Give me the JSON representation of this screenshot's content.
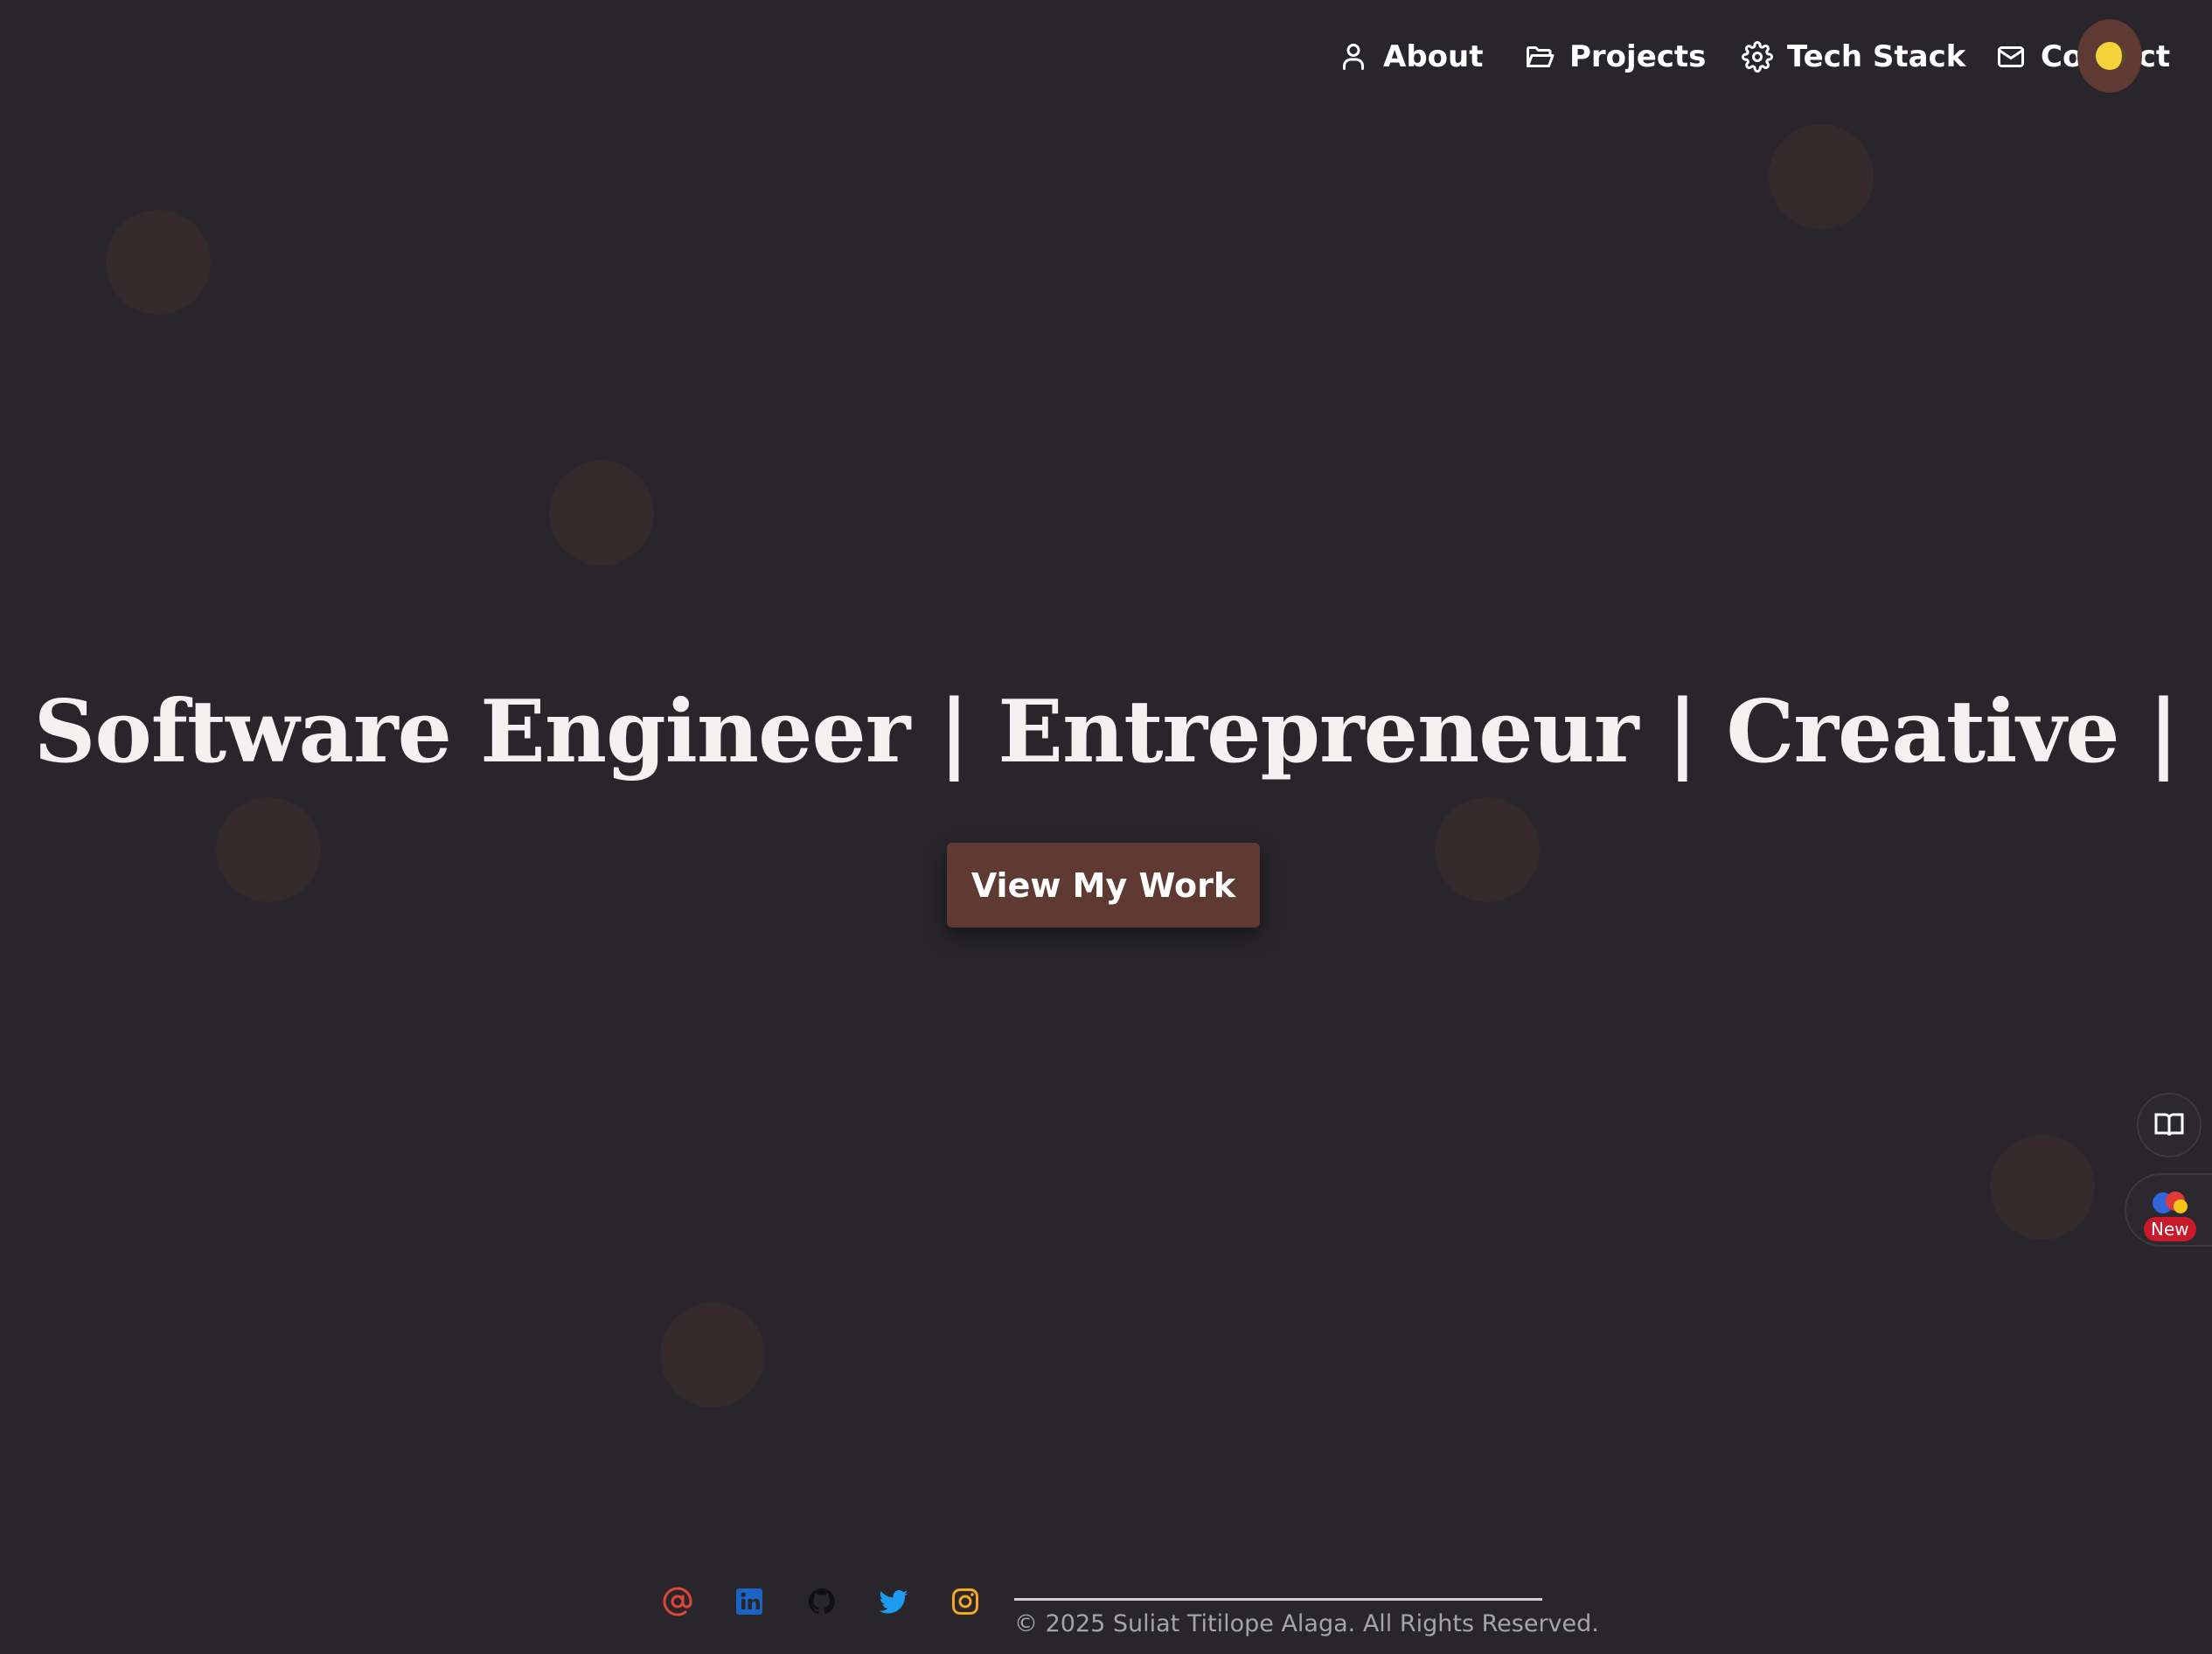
{
  "nav": {
    "items": [
      {
        "label": "About",
        "icon": "user-icon"
      },
      {
        "label": "Projects",
        "icon": "folder-icon"
      },
      {
        "label": "Tech Stack",
        "icon": "gear-icon"
      },
      {
        "label": "Contact",
        "icon": "mail-icon"
      }
    ],
    "theme_toggle_icon": "moon-icon"
  },
  "hero": {
    "headline": "Software Engineer | Entrepreneur | Creative |",
    "cta_label": "View My Work"
  },
  "side_widgets": {
    "book_icon": "book-icon",
    "new_badge": "New"
  },
  "footer": {
    "social": [
      "email-icon",
      "linkedin-icon",
      "github-icon",
      "twitter-icon",
      "instagram-icon"
    ],
    "copyright": "© 2025 Suliat Titilope Alaga. All Rights Reserved."
  },
  "colors": {
    "background": "#28262b",
    "accent": "#5e3a33",
    "text": "#ffffff",
    "muted_text": "#a4a4aa",
    "bubble": "#34292b"
  }
}
